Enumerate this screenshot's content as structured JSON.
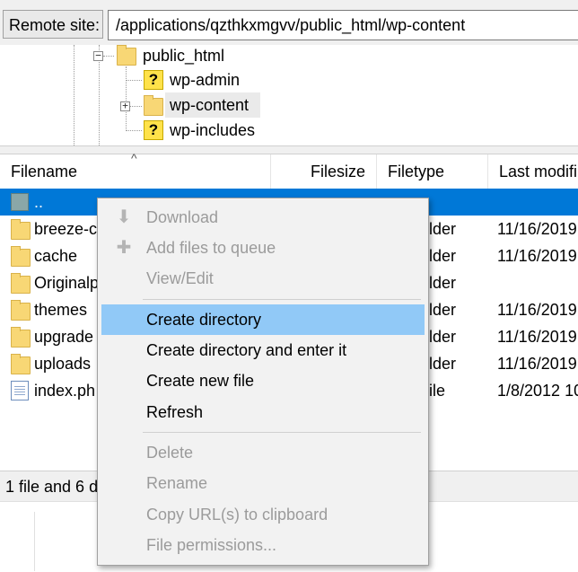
{
  "remote_site": {
    "label": "Remote site:",
    "path": "/applications/qzthkxmgvv/public_html/wp-content"
  },
  "tree": {
    "items": [
      {
        "name": "public_html",
        "icon": "folder-icon",
        "expander": "−"
      },
      {
        "name": "wp-admin",
        "icon": "unknown-folder-icon"
      },
      {
        "name": "wp-content",
        "icon": "folder-icon",
        "expander": "+"
      },
      {
        "name": "wp-includes",
        "icon": "unknown-folder-icon"
      }
    ]
  },
  "file_list": {
    "columns": [
      "Filename",
      "Filesize",
      "Filetype",
      "Last modifi"
    ],
    "sort_indicator": "^",
    "rows": [
      {
        "name": "..",
        "type": "",
        "modified": "",
        "icon": "parent-folder-icon",
        "selected": true
      },
      {
        "name": "breeze-c",
        "type": "lder",
        "modified": "11/16/2019",
        "icon": "folder-icon"
      },
      {
        "name": "cache",
        "type": "lder",
        "modified": "11/16/2019",
        "icon": "folder-icon"
      },
      {
        "name": "Originalp",
        "type": "lder",
        "modified": "",
        "icon": "folder-icon"
      },
      {
        "name": "themes",
        "type": "lder",
        "modified": "11/16/2019",
        "icon": "folder-icon"
      },
      {
        "name": "upgrade",
        "type": "lder",
        "modified": "11/16/2019",
        "icon": "folder-icon"
      },
      {
        "name": "uploads",
        "type": "lder",
        "modified": "11/16/2019",
        "icon": "folder-icon"
      },
      {
        "name": "index.ph",
        "type": "ile",
        "modified": "1/8/2012 10",
        "icon": "php-file-icon"
      }
    ]
  },
  "status_bar": {
    "text": "1 file and 6 d"
  },
  "context_menu": {
    "items": [
      {
        "label": "Download",
        "enabled": false,
        "icon": "download-icon"
      },
      {
        "label": "Add files to queue",
        "enabled": false,
        "icon": "add-to-queue-icon"
      },
      {
        "label": "View/Edit",
        "enabled": false
      },
      {
        "label": "Create directory",
        "enabled": true,
        "highlighted": true
      },
      {
        "label": "Create directory and enter it",
        "enabled": true
      },
      {
        "label": "Create new file",
        "enabled": true
      },
      {
        "label": "Refresh",
        "enabled": true
      },
      {
        "label": "Delete",
        "enabled": false
      },
      {
        "label": "Rename",
        "enabled": false
      },
      {
        "label": "Copy URL(s) to clipboard",
        "enabled": false
      },
      {
        "label": "File permissions...",
        "enabled": false
      }
    ]
  },
  "colors": {
    "selection": "#0078d7",
    "menu_highlight": "#91c9f7",
    "folder": "#f8d775"
  }
}
